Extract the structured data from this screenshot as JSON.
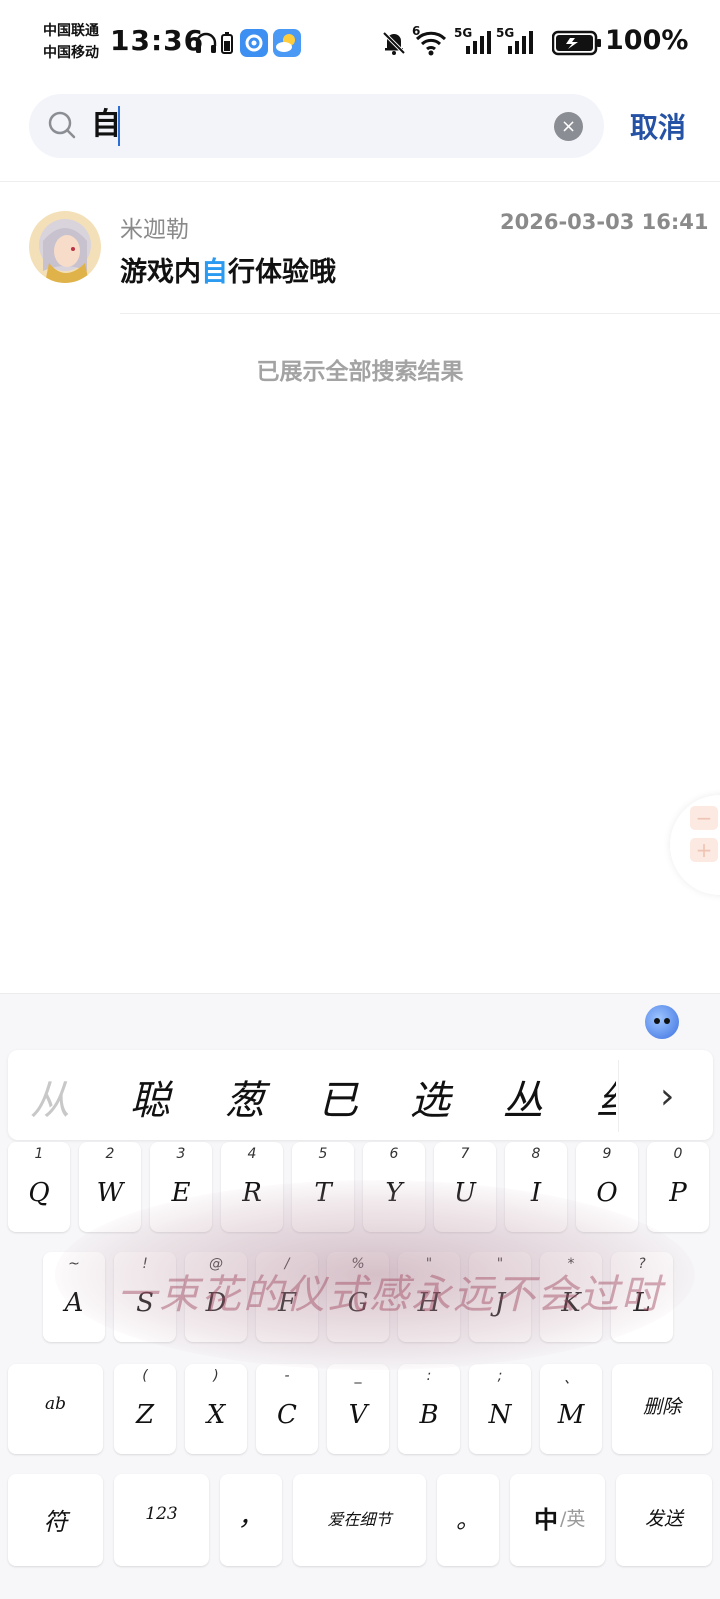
{
  "status_bar": {
    "carrier_1": "中国联通",
    "carrier_2": "中国移动",
    "time": "13:36",
    "signal_1": "5G",
    "signal_2": "5G",
    "wifi_label": "6",
    "battery_percent": "100%"
  },
  "search": {
    "query": "自",
    "clear_icon": "×",
    "cancel_label": "取消"
  },
  "result": {
    "name": "米迦勒",
    "timestamp": "2026-03-03 16:41",
    "message_before": "游戏内",
    "message_highlight": "自",
    "message_after": "行体验哦",
    "highlight_color": "#2a9bf0"
  },
  "all_shown": "已展示全部搜索结果",
  "zoom": {
    "minus": "−",
    "plus": "+"
  },
  "keyboard": {
    "candidates": [
      "从",
      "聪",
      "葱",
      "已",
      "选",
      "丛",
      "丝"
    ],
    "more_icon": "›",
    "theme_text": "一束花的仪式感永远不会过时",
    "row1": [
      {
        "main": "Q",
        "sub": "1"
      },
      {
        "main": "W",
        "sub": "2"
      },
      {
        "main": "E",
        "sub": "3"
      },
      {
        "main": "R",
        "sub": "4"
      },
      {
        "main": "T",
        "sub": "5"
      },
      {
        "main": "Y",
        "sub": "6"
      },
      {
        "main": "U",
        "sub": "7"
      },
      {
        "main": "I",
        "sub": "8"
      },
      {
        "main": "O",
        "sub": "9"
      },
      {
        "main": "P",
        "sub": "0"
      }
    ],
    "row2": [
      {
        "main": "A",
        "sub": "~"
      },
      {
        "main": "S",
        "sub": "!"
      },
      {
        "main": "D",
        "sub": "@"
      },
      {
        "main": "F",
        "sub": "/"
      },
      {
        "main": "G",
        "sub": "%"
      },
      {
        "main": "H",
        "sub": "\""
      },
      {
        "main": "J",
        "sub": "\""
      },
      {
        "main": "K",
        "sub": "*"
      },
      {
        "main": "L",
        "sub": "?"
      }
    ],
    "row3": [
      {
        "main": "Z",
        "sub": "("
      },
      {
        "main": "X",
        "sub": ")"
      },
      {
        "main": "C",
        "sub": "-"
      },
      {
        "main": "V",
        "sub": "_"
      },
      {
        "main": "B",
        "sub": ":"
      },
      {
        "main": "N",
        "sub": ";"
      },
      {
        "main": "M",
        "sub": "、"
      }
    ],
    "ab_label": "ab",
    "delete_label": "删除",
    "symbol_label": "符",
    "numbers_label": "123",
    "comma_label": "，",
    "space_label": "爱在细节",
    "period_label": "。",
    "lang_zh": "中",
    "lang_en": "/英",
    "send_label": "发送"
  }
}
